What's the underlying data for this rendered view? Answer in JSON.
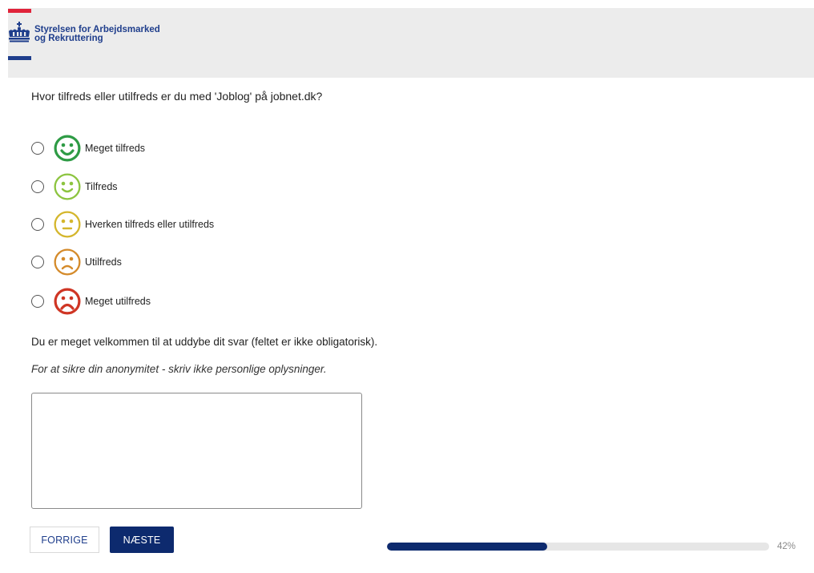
{
  "header": {
    "logo_line1": "Styrelsen for Arbejdsmarked",
    "logo_line2": "og Rekruttering"
  },
  "question": "Hvor tilfreds eller utilfreds er du med 'Joblog' på jobnet.dk?",
  "options": [
    {
      "label": "Meget tilfreds",
      "color": "#2e9b45",
      "mood": "very-happy",
      "icon": "very-happy-face-icon"
    },
    {
      "label": "Tilfreds",
      "color": "#8cc43f",
      "mood": "happy",
      "icon": "happy-face-icon"
    },
    {
      "label": "Hverken tilfreds eller utilfreds",
      "color": "#d4b62c",
      "mood": "neutral",
      "icon": "neutral-face-icon"
    },
    {
      "label": "Utilfreds",
      "color": "#d48a2a",
      "mood": "sad",
      "icon": "sad-face-icon"
    },
    {
      "label": "Meget utilfreds",
      "color": "#cf3524",
      "mood": "very-sad",
      "icon": "very-sad-face-icon"
    }
  ],
  "elaborate_text": "Du er meget velkommen til at uddybe dit svar (feltet er ikke obligatorisk).",
  "anonymity_text": "For at sikre din anonymitet - skriv ikke personlige oplysninger.",
  "comment": {
    "value": "",
    "placeholder": ""
  },
  "buttons": {
    "prev_label": "FORRIGE",
    "next_label": "NÆSTE"
  },
  "progress": {
    "percent": 42,
    "label": "42%"
  },
  "colors": {
    "brand_blue": "#1f3e8c",
    "brand_red": "#e0233a",
    "button_dark": "#0d2a6e"
  }
}
